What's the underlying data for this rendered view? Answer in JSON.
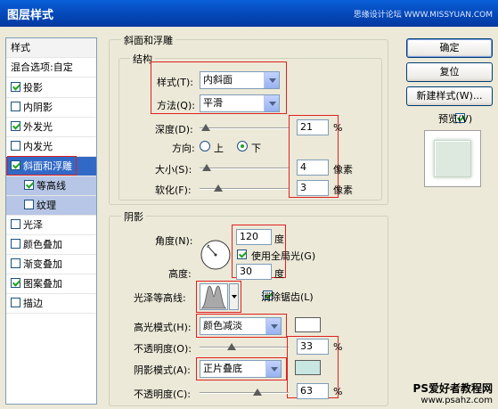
{
  "window": {
    "title": "图层样式",
    "watermark": "思缘设计论坛 WWW.MISSYUAN.COM"
  },
  "style_list": {
    "items": [
      {
        "label": "样式",
        "checkbox": false,
        "checked": false
      },
      {
        "label": "混合选项:自定",
        "checkbox": false,
        "checked": false
      },
      {
        "label": "投影",
        "checkbox": true,
        "checked": true
      },
      {
        "label": "内阴影",
        "checkbox": true,
        "checked": false
      },
      {
        "label": "外发光",
        "checkbox": true,
        "checked": true
      },
      {
        "label": "内发光",
        "checkbox": true,
        "checked": false
      },
      {
        "label": "斜面和浮雕",
        "checkbox": true,
        "checked": true,
        "selected": true
      },
      {
        "label": "等高线",
        "checkbox": true,
        "checked": true,
        "sub": true
      },
      {
        "label": "纹理",
        "checkbox": true,
        "checked": false,
        "sub": true
      },
      {
        "label": "光泽",
        "checkbox": true,
        "checked": false
      },
      {
        "label": "颜色叠加",
        "checkbox": true,
        "checked": false
      },
      {
        "label": "渐变叠加",
        "checkbox": true,
        "checked": false
      },
      {
        "label": "图案叠加",
        "checkbox": true,
        "checked": true
      },
      {
        "label": "描边",
        "checkbox": true,
        "checked": false
      }
    ]
  },
  "bevel": {
    "group_title": "斜面和浮雕",
    "structure_title": "结构",
    "style_label": "样式(T):",
    "style_value": "内斜面",
    "technique_label": "方法(Q):",
    "technique_value": "平滑",
    "depth_label": "深度(D):",
    "depth_value": "21",
    "depth_unit": "%",
    "direction_label": "方向:",
    "direction_up": "上",
    "direction_down": "下",
    "size_label": "大小(S):",
    "size_value": "4",
    "size_unit": "像素",
    "soften_label": "软化(F):",
    "soften_value": "3",
    "soften_unit": "像素"
  },
  "shading": {
    "title": "阴影",
    "angle_label": "角度(N):",
    "angle_value": "120",
    "angle_unit": "度",
    "global_light_label": "使用全局光(G)",
    "altitude_label": "高度:",
    "altitude_value": "30",
    "altitude_unit": "度",
    "gloss_contour_label": "光泽等高线:",
    "anti_alias_label": "消除锯齿(L)",
    "highlight_mode_label": "高光模式(H):",
    "highlight_mode_value": "颜色减淡",
    "highlight_opacity_label": "不透明度(O):",
    "highlight_opacity_value": "33",
    "highlight_opacity_unit": "%",
    "shadow_mode_label": "阴影模式(A):",
    "shadow_mode_value": "正片叠底",
    "shadow_opacity_label": "不透明度(C):",
    "shadow_opacity_value": "63",
    "shadow_opacity_unit": "%",
    "highlight_color": "#ffffff",
    "shadow_color": "#c8e6e2"
  },
  "buttons": {
    "ok": "确定",
    "reset": "复位",
    "new_style": "新建样式(W)...",
    "preview": "预览(V)"
  },
  "footer_watermark": {
    "line1": "PS爱好者教程网",
    "line2": "www.psahz.com"
  }
}
